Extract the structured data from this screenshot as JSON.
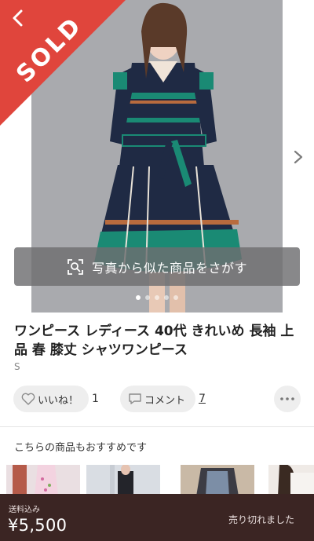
{
  "sold_label": "SOLD",
  "photo_search": {
    "label": "写真から似た商品をさがす",
    "icon": "photo-search-icon"
  },
  "carousel": {
    "count": 5,
    "active": 1
  },
  "item": {
    "title": "ワンピース レディース 40代 きれいめ 長袖 上品 春 膝丈 シャツワンピース",
    "size": "S"
  },
  "actions": {
    "like_label": "いいね！",
    "like_count": "1",
    "comment_label": "コメント",
    "comment_count": "7"
  },
  "recommend": {
    "title": "こちらの商品もおすすめです"
  },
  "bottom_bar": {
    "shipping": "送料込み",
    "price": "¥5,500",
    "status": "売り切れました"
  },
  "colors": {
    "sold_red": "#e0453c",
    "bottom_bar": "#3b2523",
    "dress_navy": "#1f2a44",
    "dress_teal": "#1a8a74"
  }
}
